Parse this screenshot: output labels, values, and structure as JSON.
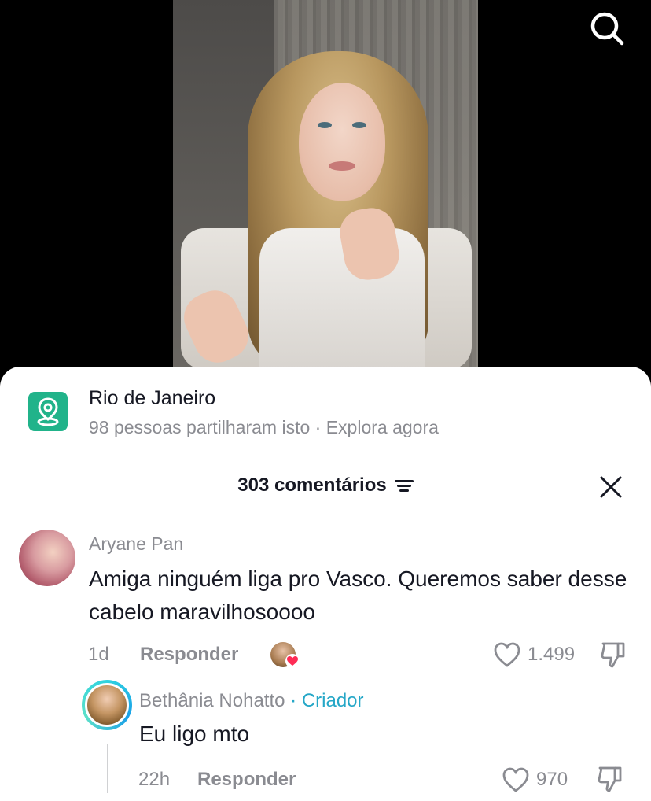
{
  "video": {
    "description_icon": "search-icon"
  },
  "location": {
    "title": "Rio de Janeiro",
    "subtitle": "98 pessoas partilharam isto · Explora agora",
    "icon": "location-pin-icon",
    "icon_color": "#21b38a"
  },
  "comments_panel": {
    "header": "303 comentários",
    "filter_icon": "filter-icon",
    "close_icon": "close-icon"
  },
  "comments": [
    {
      "author": "Aryane Pan",
      "text": "Amiga ninguém liga pro Vasco. Queremos saber desse cabelo maravilhosoooo",
      "time": "1d",
      "reply_label": "Responder",
      "likes": "1.499",
      "creator_liked": true
    },
    {
      "author": "Bethânia Nohatto",
      "badge": "· Criador",
      "text": "Eu ligo mto",
      "time": "22h",
      "reply_label": "Responder",
      "likes": "970"
    }
  ],
  "colors": {
    "creator_badge": "#25a7c7",
    "muted_text": "#8a8b91",
    "heart": "#fe2c55"
  }
}
